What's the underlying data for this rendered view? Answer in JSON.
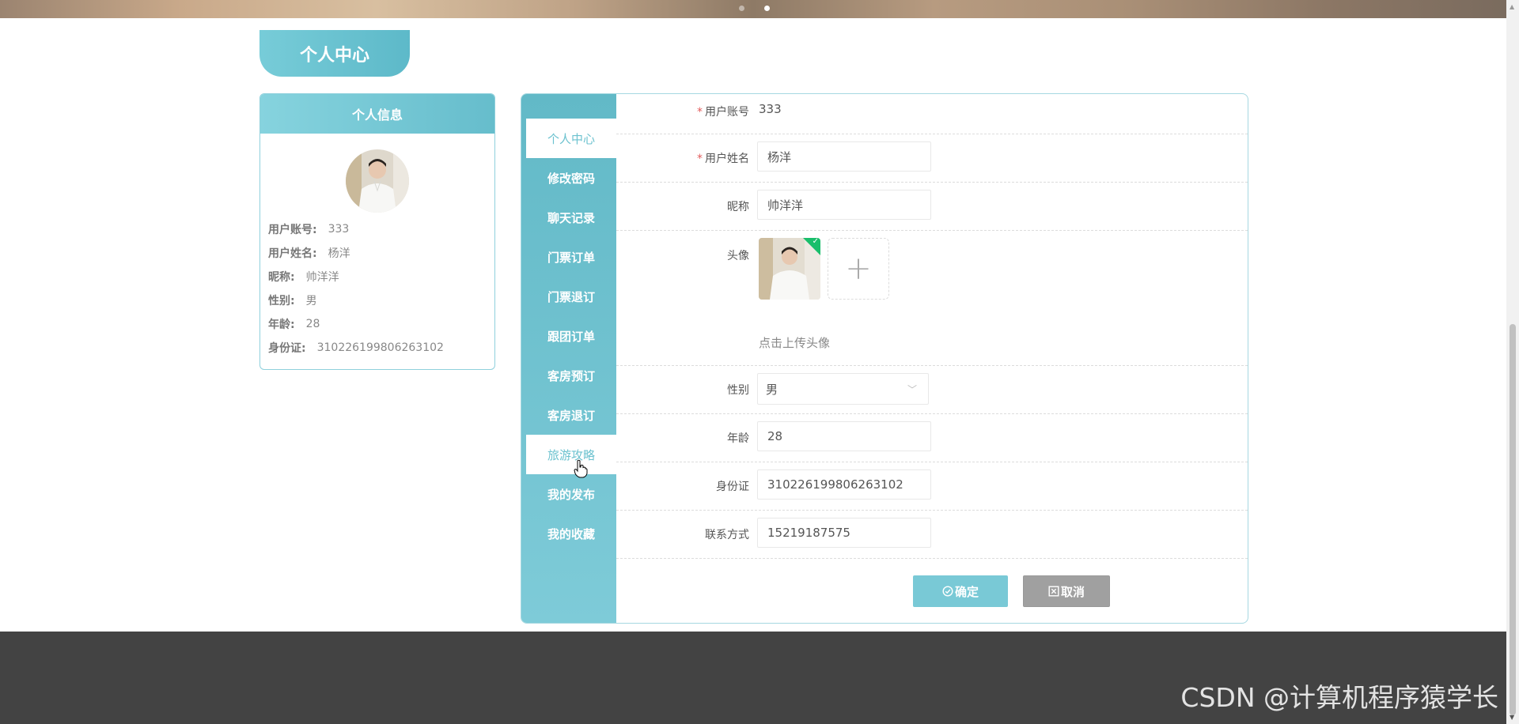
{
  "page": {
    "title": "个人中心"
  },
  "info_card": {
    "title": "个人信息",
    "rows": [
      {
        "key": "用户账号:",
        "value": "333"
      },
      {
        "key": "用户姓名:",
        "value": "杨洋"
      },
      {
        "key": "昵称:",
        "value": "帅洋洋"
      },
      {
        "key": "性别:",
        "value": "男"
      },
      {
        "key": "年龄:",
        "value": "28"
      },
      {
        "key": "身份证:",
        "value": "310226199806263102"
      }
    ]
  },
  "menu": {
    "items": [
      {
        "label": "个人中心"
      },
      {
        "label": "修改密码"
      },
      {
        "label": "聊天记录"
      },
      {
        "label": "门票订单"
      },
      {
        "label": "门票退订"
      },
      {
        "label": "跟团订单"
      },
      {
        "label": "客房预订"
      },
      {
        "label": "客房退订"
      },
      {
        "label": "旅游攻略"
      },
      {
        "label": "我的发布"
      },
      {
        "label": "我的收藏"
      }
    ]
  },
  "form": {
    "required_mark": "*",
    "account": {
      "label": "用户账号",
      "value": "333"
    },
    "name": {
      "label": "用户姓名",
      "value": "杨洋"
    },
    "nickname": {
      "label": "昵称",
      "value": "帅洋洋"
    },
    "avatar": {
      "label": "头像",
      "hint": "点击上传头像",
      "add_symbol": "+"
    },
    "gender": {
      "label": "性别",
      "value": "男"
    },
    "age": {
      "label": "年龄",
      "value": "28"
    },
    "id_card": {
      "label": "身份证",
      "value": "310226199806263102"
    },
    "contact": {
      "label": "联系方式",
      "value": "15219187575"
    },
    "confirm_label": "确定",
    "cancel_label": "取消"
  },
  "watermark": "CSDN @计算机程序猿学长",
  "colors": {
    "accent": "#6cc2cf",
    "success": "#19be6b",
    "footer": "#434343",
    "cancel": "#a0a0a0"
  },
  "icons": {
    "confirm": "check-circle-icon",
    "cancel": "close-square-icon",
    "select": "chevron-down-icon",
    "upload_done": "check-icon",
    "cursor": "hand-pointer-icon"
  }
}
